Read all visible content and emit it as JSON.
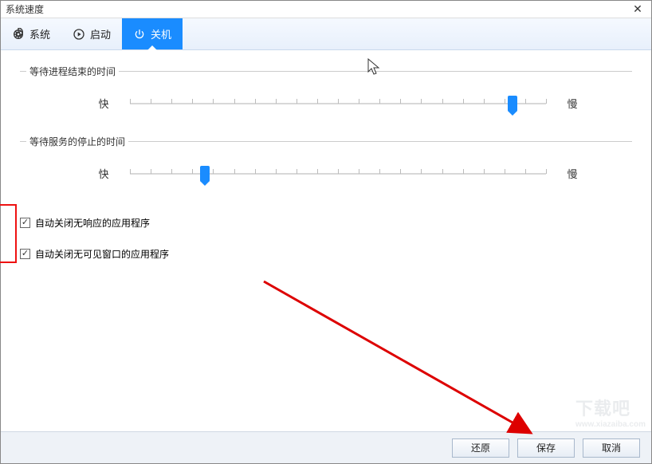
{
  "window": {
    "title": "系统速度",
    "close": "✕"
  },
  "tabs": [
    {
      "key": "system",
      "label": "系统",
      "icon": "gear-icon",
      "active": false
    },
    {
      "key": "startup",
      "label": "启动",
      "icon": "play-icon",
      "active": false
    },
    {
      "key": "shutdown",
      "label": "关机",
      "icon": "power-icon",
      "active": true
    }
  ],
  "sliders": {
    "fast_label": "快",
    "slow_label": "慢",
    "process_end": {
      "title": "等待进程结束的时间",
      "value_percent": 92
    },
    "service_stop": {
      "title": "等待服务的停止的时间",
      "value_percent": 18
    }
  },
  "checkboxes": {
    "close_unresponsive": {
      "label": "自动关闭无响应的应用程序",
      "checked": true
    },
    "close_no_window": {
      "label": "自动关闭无可见窗口的应用程序",
      "checked": true
    }
  },
  "footer": {
    "restore": "还原",
    "save": "保存",
    "cancel": "取消"
  },
  "watermark": {
    "main": "下载吧",
    "sub": "www.xiazaiba.com"
  }
}
